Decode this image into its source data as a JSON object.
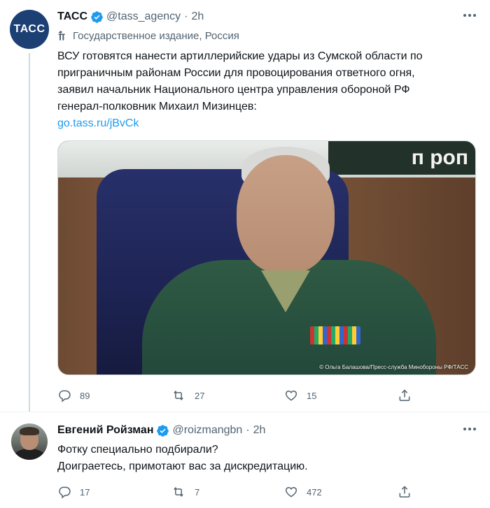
{
  "tweets": [
    {
      "avatar_text": "ТАСС",
      "name": "ТАСС",
      "handle": "@tass_agency",
      "time": "2h",
      "label": "Государственное издание, Россия",
      "text_lines": [
        "ВСУ готовятся нанести артиллерийские удары из Сумской области по",
        "приграничным районам России для провоцирования ответного огня,",
        "заявил начальник Национального центра управления обороной РФ",
        "генерал-полковник Михаил Мизинцев:"
      ],
      "link": "go.tass.ru/jBvCk",
      "media": {
        "sign_text": "п роп",
        "credit": "© Ольга Балашова/Пресс-служба Минобороны РФ/ТАСС"
      },
      "counts": {
        "replies": "89",
        "retweets": "27",
        "likes": "15"
      }
    },
    {
      "name": "Евгений Ройзман",
      "handle": "@roizmangbn",
      "time": "2h",
      "text_lines": [
        "Фотку специально подбирали?",
        "Доиграетесь, примотают вас за дискредитацию."
      ],
      "counts": {
        "replies": "17",
        "retweets": "7",
        "likes": "472"
      }
    }
  ],
  "colors": {
    "accent": "#1d9bf0",
    "secondary_text": "#536471",
    "verified": "#1d9bf0",
    "thread_line": "#cfd9de"
  },
  "icons": [
    "verified-badge-icon",
    "government-label-icon",
    "reply-icon",
    "retweet-icon",
    "like-icon",
    "share-icon",
    "more-icon"
  ]
}
